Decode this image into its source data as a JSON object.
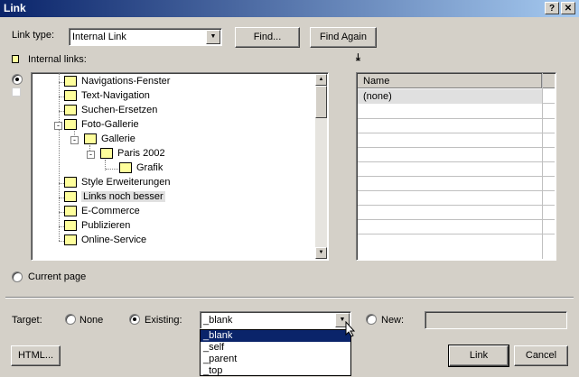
{
  "window": {
    "title": "Link",
    "help_label": "?",
    "close_label": "✕"
  },
  "link_type": {
    "label": "Link type:",
    "value": "Internal Link"
  },
  "buttons": {
    "find": "Find...",
    "find_again": "Find Again",
    "html": "HTML...",
    "link": "Link",
    "cancel": "Cancel"
  },
  "internal_links": {
    "label": "Internal links:",
    "anchor_glyph": "⤓"
  },
  "tree": {
    "items": [
      {
        "label": "Navigations-Fenster"
      },
      {
        "label": "Text-Navigation"
      },
      {
        "label": "Suchen-Ersetzen"
      },
      {
        "label": "Foto-Gallerie"
      },
      {
        "label": "Gallerie"
      },
      {
        "label": "Paris 2002"
      },
      {
        "label": "Grafik"
      },
      {
        "label": "Style Erweiterungen"
      },
      {
        "label": "Links noch besser"
      },
      {
        "label": "E-Commerce"
      },
      {
        "label": "Publizieren"
      },
      {
        "label": "Online-Service"
      }
    ]
  },
  "anchors": {
    "column_header": "Name",
    "rows": [
      "(none)"
    ]
  },
  "current_page": {
    "label": "Current page"
  },
  "target": {
    "label": "Target:",
    "none_label": "None",
    "existing_label": "Existing:",
    "existing_value": "_blank",
    "new_label": "New:",
    "new_value": "",
    "options": [
      "_blank",
      "_self",
      "_parent",
      "_top"
    ]
  }
}
